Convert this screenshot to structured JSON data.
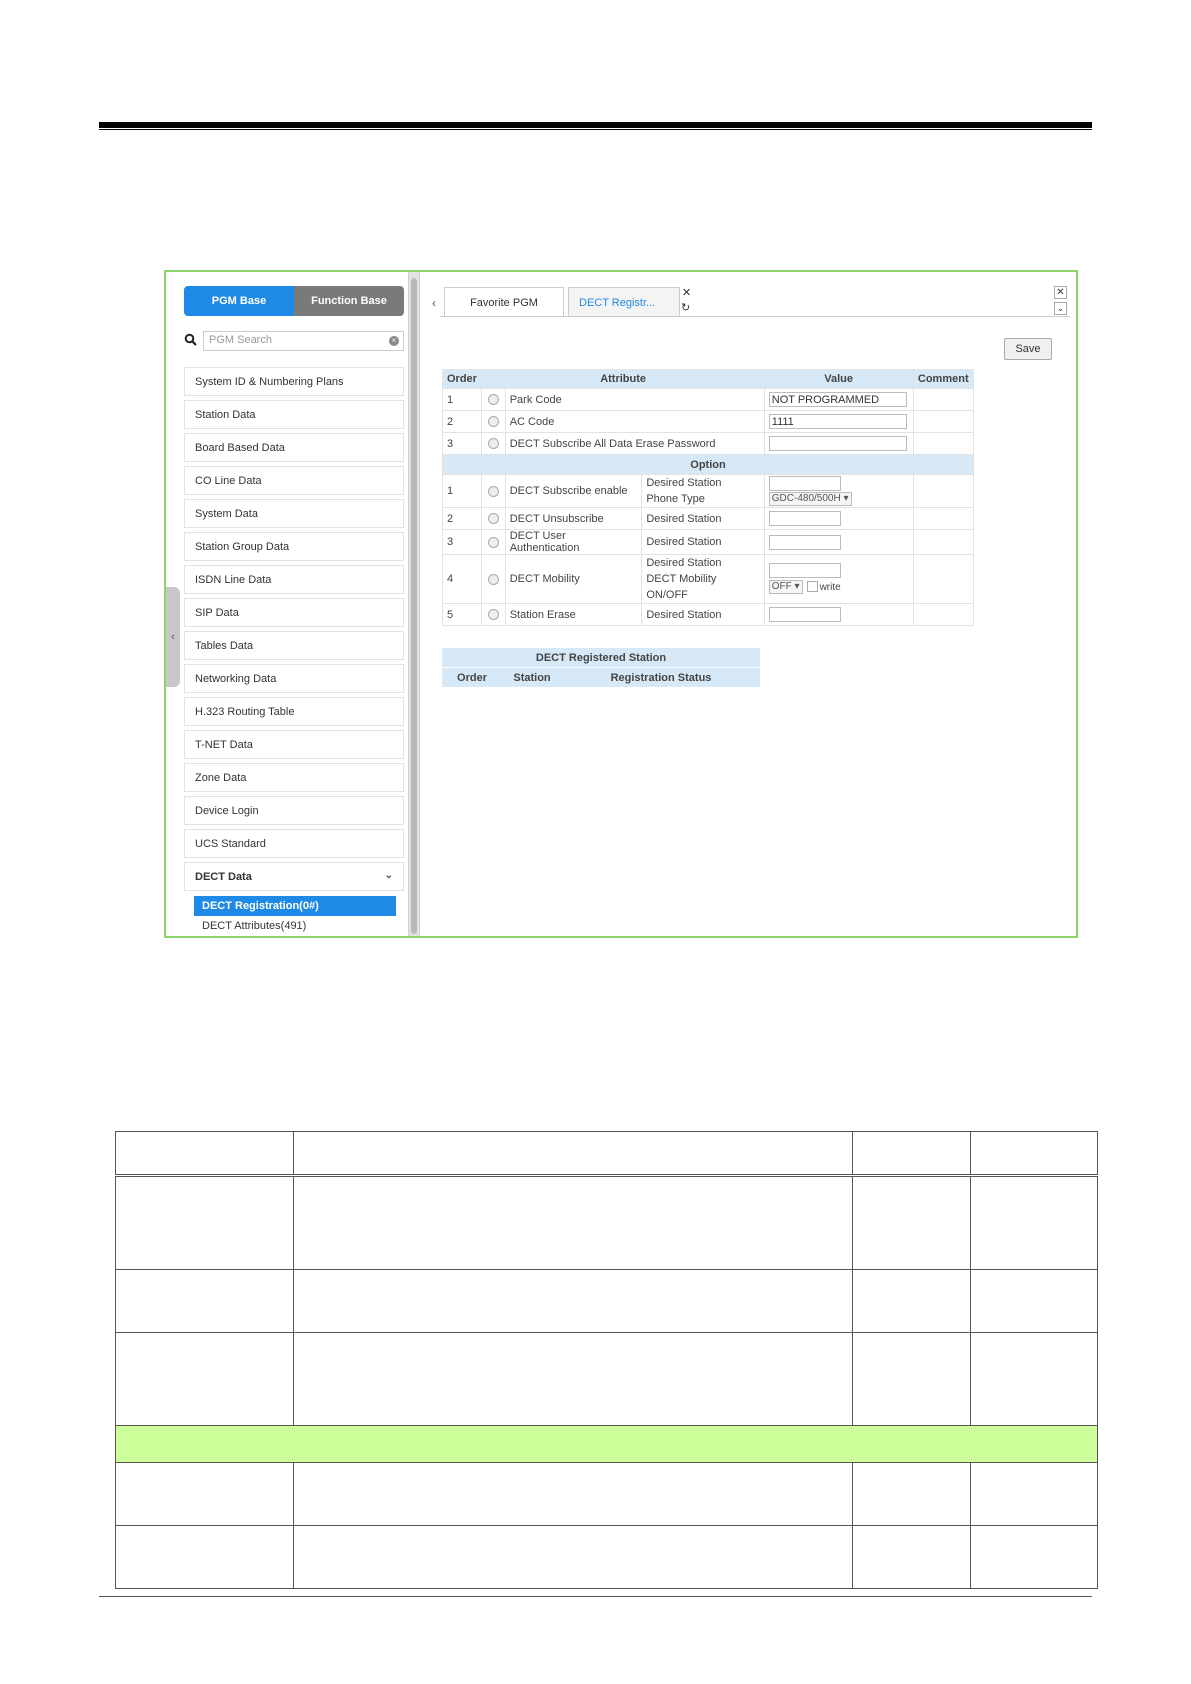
{
  "ui": {
    "toggle": {
      "pgm_base": "PGM Base",
      "function_base": "Function Base"
    },
    "search": {
      "placeholder": "PGM Search"
    },
    "menu": [
      "System ID & Numbering Plans",
      "Station Data",
      "Board Based Data",
      "CO Line Data",
      "System Data",
      "Station Group Data",
      "ISDN Line Data",
      "SIP Data",
      "Tables Data",
      "Networking Data",
      "H.323 Routing Table",
      "T-NET Data",
      "Zone Data",
      "Device Login",
      "UCS Standard",
      "DECT Data"
    ],
    "submenu": {
      "active": "DECT Registration(0#)",
      "next": "DECT Attributes(491)"
    },
    "tabs": {
      "favorite": "Favorite PGM",
      "active": "DECT Registr..."
    },
    "save_label": "Save",
    "table": {
      "headers": {
        "order": "Order",
        "attribute": "Attribute",
        "value": "Value",
        "comment": "Comment"
      },
      "rows": [
        {
          "order": "1",
          "attribute": "Park Code",
          "value": "NOT PROGRAMMED"
        },
        {
          "order": "2",
          "attribute": "AC Code",
          "value": "1111"
        },
        {
          "order": "3",
          "attribute": "DECT Subscribe All Data Erase Password",
          "value": ""
        }
      ],
      "option_label": "Option",
      "option_rows": [
        {
          "order": "1",
          "attribute": "DECT Subscribe enable",
          "sub1": "Desired Station",
          "sub2": "Phone Type",
          "select": "GDC-480/500H"
        },
        {
          "order": "2",
          "attribute": "DECT Unsubscribe",
          "sub1": "Desired Station"
        },
        {
          "order": "3",
          "attribute": "DECT User Authentication",
          "sub1": "Desired Station"
        },
        {
          "order": "4",
          "attribute": "DECT Mobility",
          "sub1": "Desired Station",
          "sub2": "DECT Mobility ON/OFF",
          "select": "OFF",
          "checkbox_label": "write"
        },
        {
          "order": "5",
          "attribute": "Station Erase",
          "sub1": "Desired Station"
        }
      ]
    },
    "registered": {
      "title": "DECT Registered Station",
      "columns": [
        "Order",
        "Station",
        "Registration Status"
      ]
    }
  }
}
